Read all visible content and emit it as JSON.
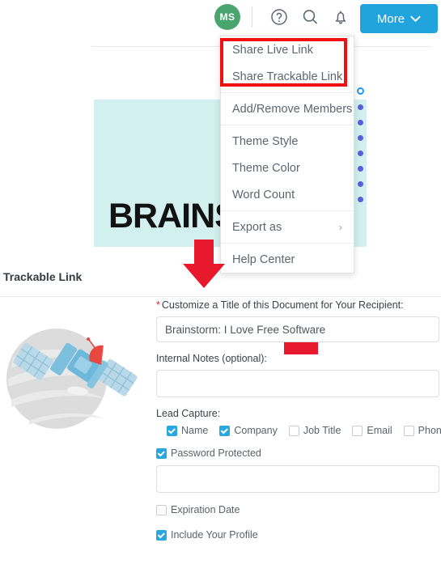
{
  "header": {
    "avatar_initials": "MS",
    "icons": [
      "help-circle-icon",
      "search-icon",
      "bell-icon"
    ],
    "more_button_label": "More"
  },
  "document": {
    "title_text": "BRAINS",
    "page_dots_count": 8
  },
  "menu": {
    "items": [
      {
        "label": "Share Live Link",
        "highlighted": true,
        "submenu": false
      },
      {
        "label": "Share Trackable Link",
        "highlighted": true,
        "submenu": false
      },
      {
        "label": "Add/Remove Members",
        "highlighted": false,
        "submenu": false
      },
      {
        "label": "Theme Style",
        "highlighted": false,
        "submenu": false
      },
      {
        "label": "Theme Color",
        "highlighted": false,
        "submenu": false
      },
      {
        "label": "Word Count",
        "highlighted": false,
        "submenu": false
      },
      {
        "label": "Export as",
        "highlighted": false,
        "submenu": true,
        "submenu_glyph": "›"
      },
      {
        "label": "Help Center",
        "highlighted": false,
        "submenu": false
      }
    ]
  },
  "panel": {
    "title": "Trackable Link",
    "title_field": {
      "required_marker": "*",
      "label": "Customize a Title of this Document for Your Recipient:",
      "value": "Brainstorm: I Love Free Software"
    },
    "notes_field": {
      "label": "Internal Notes (optional):",
      "value": ""
    },
    "lead_capture": {
      "label": "Lead Capture:",
      "options": [
        {
          "label": "Name",
          "checked": true
        },
        {
          "label": "Company",
          "checked": true
        },
        {
          "label": "Job Title",
          "checked": false
        },
        {
          "label": "Email",
          "checked": false
        },
        {
          "label": "Phone",
          "checked": false
        }
      ]
    },
    "password": {
      "label": "Password Protected",
      "checked": true,
      "value": ""
    },
    "expiration": {
      "label": "Expiration Date",
      "checked": false
    },
    "include_profile": {
      "label": "Include Your Profile",
      "checked": true
    }
  },
  "colors": {
    "accent_blue": "#21a3dd",
    "checkbox_blue": "#29a8e0",
    "avatar_green": "#4aa46e",
    "doc_teal": "#d2f0ef",
    "annotation_red": "#ee1111",
    "required_red": "#e8192c"
  }
}
